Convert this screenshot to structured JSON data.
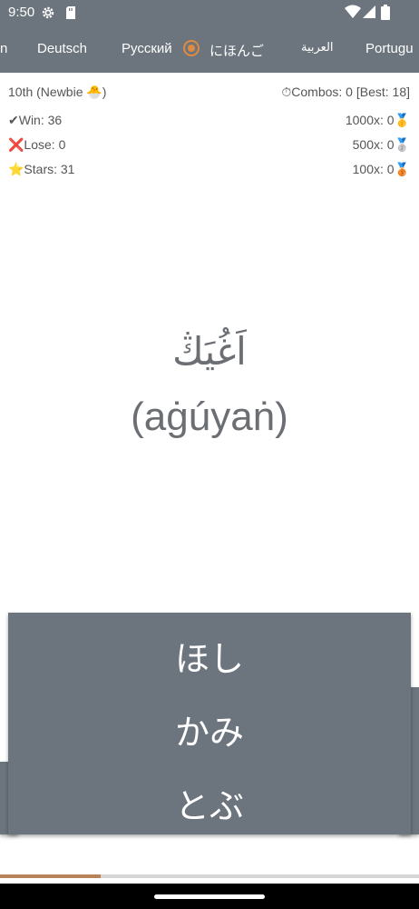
{
  "status_bar": {
    "time": "9:50",
    "icons": [
      "gear-icon",
      "sd-card-icon",
      "wifi-icon",
      "signal-icon",
      "battery-icon"
    ]
  },
  "tabs": [
    {
      "label": "n"
    },
    {
      "label": "Deutsch"
    },
    {
      "label": "Русский"
    },
    {
      "label": "にほんご",
      "selected": true
    },
    {
      "label": "العربية"
    },
    {
      "label": "Portugu"
    }
  ],
  "stats": {
    "rank": "10th (Newbie 🐣)",
    "combos": "⏱Combos: 0 [Best: 18]",
    "win": "✔Win: 36",
    "lose": "❌Lose: 0",
    "stars": "⭐Stars: 31",
    "medal_gold": "1000x: 0🥇",
    "medal_silver": "500x: 0🥈",
    "medal_bronze": "100x: 0🥉"
  },
  "question": {
    "arabic": "اَغُيَڭ",
    "transliteration": "(aġúyaṅ)"
  },
  "answers": [
    "ほし",
    "かみ",
    "とぶ"
  ],
  "progress": 0.24,
  "colors": {
    "bar": "#6c757d",
    "accent": "#e0893f",
    "progress": "#b9835a"
  }
}
